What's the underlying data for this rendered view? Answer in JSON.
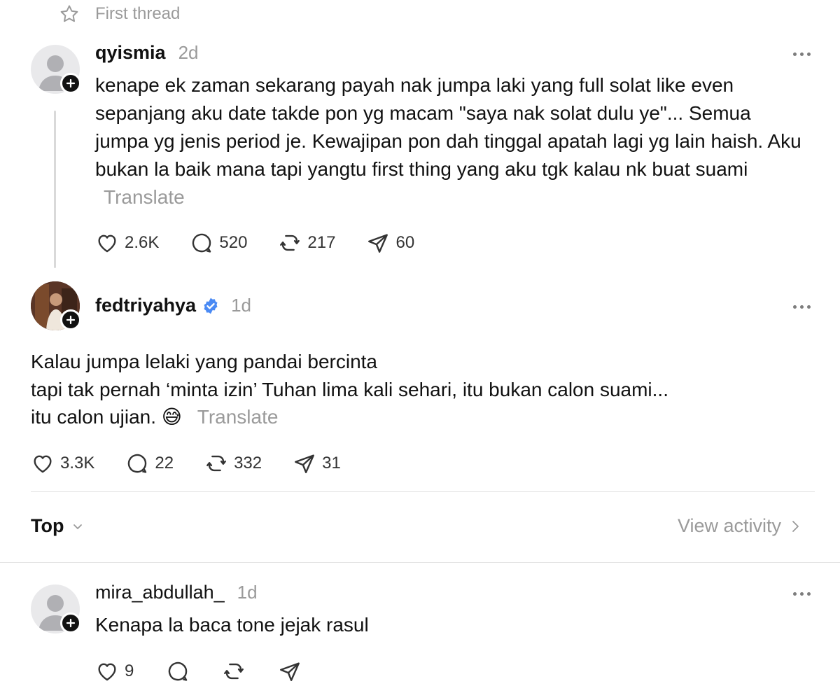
{
  "thread_header": {
    "label": "First thread"
  },
  "posts": [
    {
      "username": "qyismia",
      "time": "2d",
      "text": "kenape ek zaman sekarang payah nak jumpa laki yang full solat like even sepanjang aku date takde pon yg macam \"saya nak solat dulu ye\"... Semua jumpa yg jenis period je. Kewajipan pon dah tinggal apatah lagi yg lain haish. Aku bukan la baik mana tapi yangtu first thing yang aku tgk kalau nk buat suami",
      "translate": "Translate",
      "likes": "2.6K",
      "replies": "520",
      "reposts": "217",
      "shares": "60"
    },
    {
      "username": "fedtriyahya",
      "verified": true,
      "time": "1d",
      "lines": [
        "Kalau jumpa lelaki yang pandai bercinta",
        "tapi tak pernah ‘minta izin’ Tuhan lima kali sehari, itu bukan calon suami...",
        "itu calon ujian. 😅"
      ],
      "translate": "Translate",
      "likes": "3.3K",
      "replies": "22",
      "reposts": "332",
      "shares": "31"
    }
  ],
  "sort": {
    "label": "Top",
    "activity_label": "View activity"
  },
  "reply": {
    "username": "mira_abdullah_",
    "time": "1d",
    "text": "Kenapa la baca tone jejak rasul",
    "likes": "9"
  },
  "colors": {
    "verified": "#4a8af4",
    "muted": "#9a9a9a",
    "accent": "#111111"
  }
}
